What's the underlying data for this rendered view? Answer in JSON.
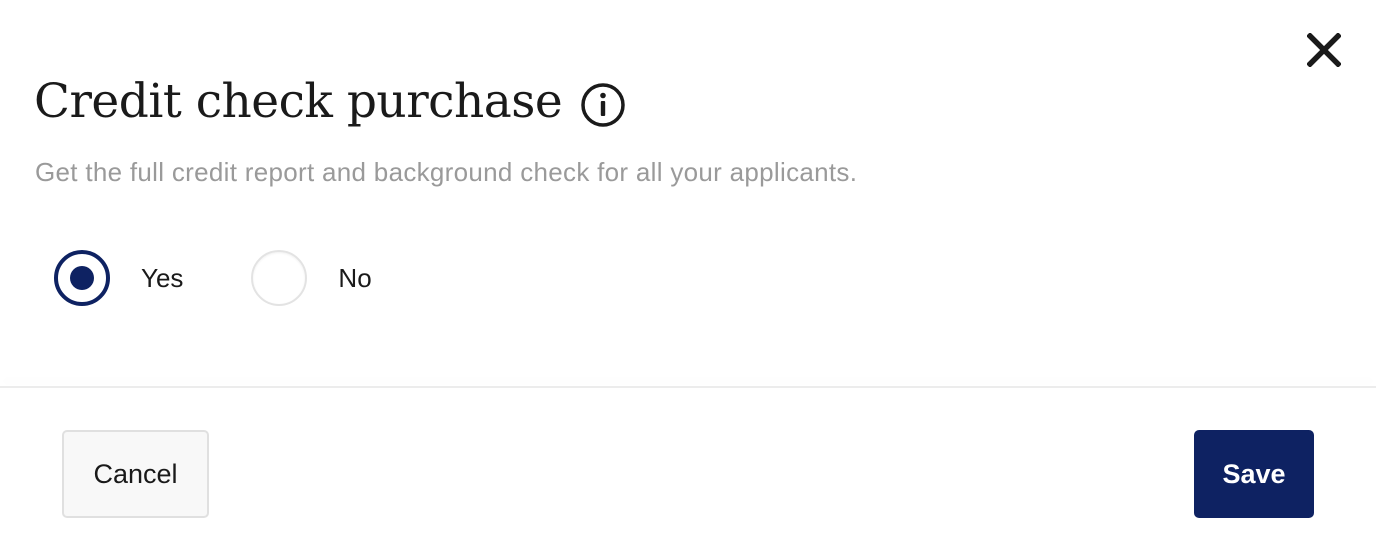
{
  "modal": {
    "title": "Credit check purchase",
    "subtitle": "Get the full credit report and background check for all your applicants.",
    "info_icon": "info-circle-icon",
    "close_icon": "close-icon"
  },
  "options": {
    "yes_label": "Yes",
    "no_label": "No",
    "selected": "Yes"
  },
  "footer": {
    "cancel_label": "Cancel",
    "save_label": "Save"
  },
  "colors": {
    "primary": "#0e2262",
    "subtitle_text": "#9a9a9a",
    "cancel_bg": "#f8f8f8"
  }
}
